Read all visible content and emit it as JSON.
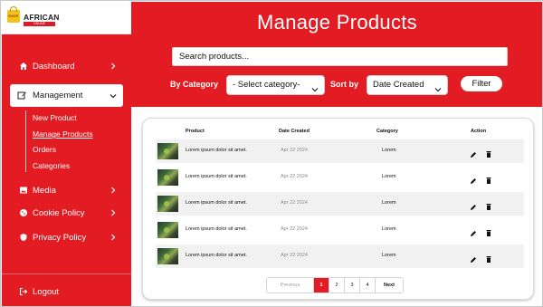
{
  "brand": {
    "logo_text": "AFRICAN",
    "logo_tag": "ONLINE MARKETPLACE",
    "bag_text": "SHOP"
  },
  "sidebar": {
    "items": [
      {
        "label": "Dashboard",
        "icon": "home-icon"
      },
      {
        "label": "Management",
        "icon": "edit-icon"
      },
      {
        "label": "Media",
        "icon": "image-icon"
      },
      {
        "label": "Cookie Policy",
        "icon": "cookie-icon"
      },
      {
        "label": "Privacy Policy",
        "icon": "shield-icon"
      }
    ],
    "sub_items": [
      {
        "label": "New Product"
      },
      {
        "label": "Manage Products"
      },
      {
        "label": "Orders"
      },
      {
        "label": "Categories"
      }
    ],
    "logout": "Logout"
  },
  "header": {
    "title": "Manage Products",
    "search_placeholder": "Search products...",
    "by_category_label": "By Category",
    "category_select": "- Select category-",
    "sort_by_label": "Sort by",
    "sort_select": "Date Created",
    "filter_button": "Filter"
  },
  "table": {
    "columns": [
      "Product",
      "Date Created",
      "Category",
      "Action"
    ],
    "rows": [
      {
        "product": "Lorem ipsum dolor sit amet.",
        "date": "Apr 22 2024",
        "category": "Lorem"
      },
      {
        "product": "Lorem ipsum dolor sit amet.",
        "date": "Apr 22 2024",
        "category": "Lorem"
      },
      {
        "product": "Lorem ipsum dolor sit amet.",
        "date": "Apr 22 2024",
        "category": "Lorem"
      },
      {
        "product": "Lorem ipsum dolor sit amet.",
        "date": "Apr 22 2024",
        "category": "Lorem"
      },
      {
        "product": "Lorem ipsum dolor sit amet.",
        "date": "Apr 22 2024",
        "category": "Lorem"
      }
    ]
  },
  "pagination": {
    "previous": "Previous",
    "pages": [
      "1",
      "2",
      "3",
      "4"
    ],
    "current_page": "1",
    "next": "Next"
  },
  "colors": {
    "accent": "#e31b23",
    "text": "#111111"
  }
}
